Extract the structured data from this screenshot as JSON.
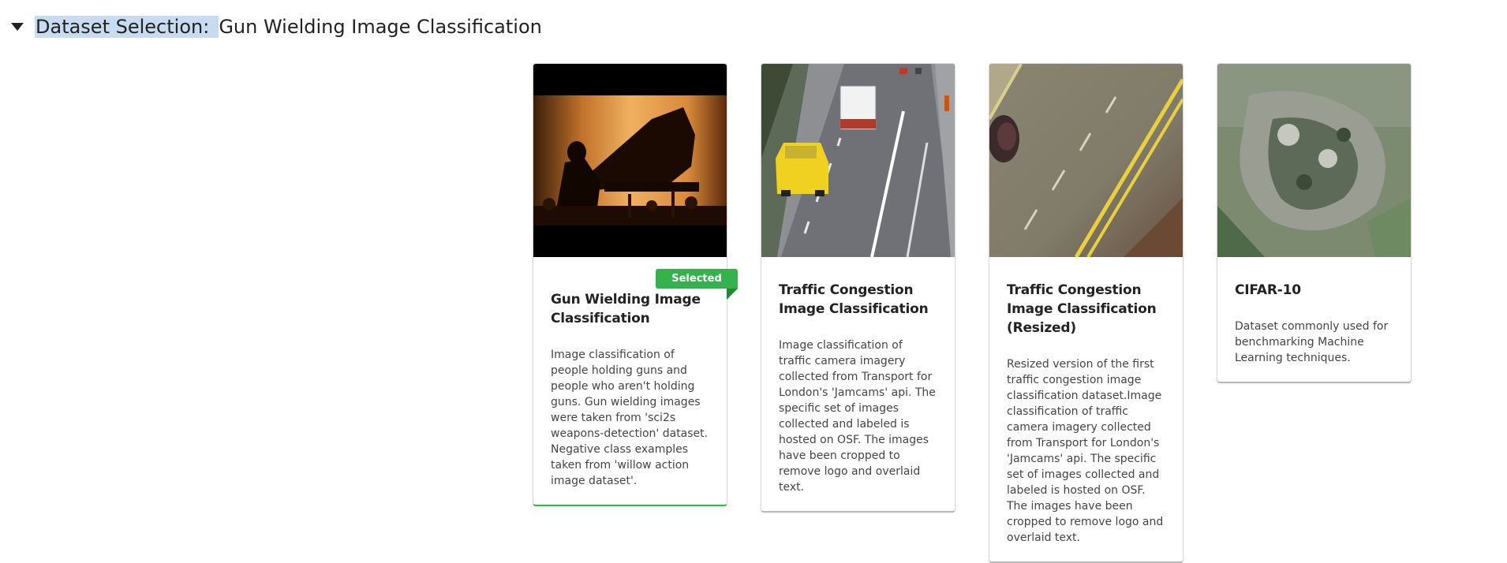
{
  "header": {
    "label": "Dataset Selection:",
    "value": "Gun Wielding Image Classification"
  },
  "cards": [
    {
      "title": "Gun Wielding Image Classification",
      "description": "Image classification of people holding guns and people who aren't holding guns. Gun wielding images were taken from 'sci2s weapons-detection' dataset. Negative class examples taken from 'willow action image dataset'.",
      "selected": true,
      "badge": "Selected"
    },
    {
      "title": "Traffic Congestion Image Classification",
      "description": "Image classification of traffic camera imagery collected from Transport for London's 'Jamcams' api. The specific set of images collected and labeled is hosted on OSF. The images have been cropped to remove logo and overlaid text.",
      "selected": false
    },
    {
      "title": "Traffic Congestion Image Classification (Resized)",
      "description": "Resized version of the first traffic congestion image classification dataset.Image classification of traffic camera imagery collected from Transport for London's 'Jamcams' api. The specific set of images collected and labeled is hosted on OSF. The images have been cropped to remove logo and overlaid text.",
      "selected": false
    },
    {
      "title": "CIFAR-10",
      "description": "Dataset commonly used for benchmarking Machine Learning techniques.",
      "selected": false
    }
  ],
  "colors": {
    "selected_accent": "#35b24d",
    "header_highlight": "#c7dcf1"
  }
}
